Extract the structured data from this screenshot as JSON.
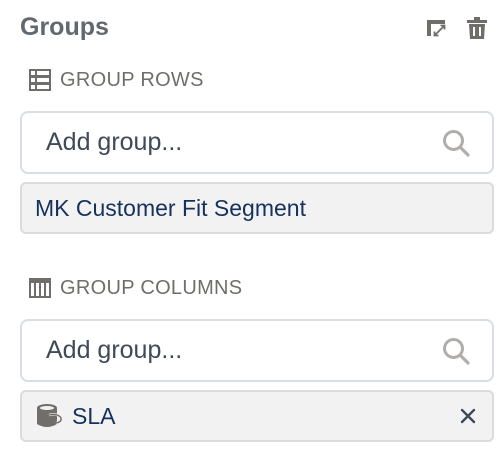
{
  "panel": {
    "title": "Groups",
    "swap_icon": "swap-axes-icon",
    "delete_icon": "trash-icon"
  },
  "group_rows": {
    "label": "GROUP ROWS",
    "icon": "rows-list-icon",
    "search": {
      "placeholder": "Add group...",
      "value": ""
    },
    "items": [
      {
        "label": "MK Customer Fit Segment"
      }
    ]
  },
  "group_columns": {
    "label": "GROUP COLUMNS",
    "icon": "columns-icon",
    "search": {
      "placeholder": "Add group...",
      "value": ""
    },
    "items": [
      {
        "label": "SLA",
        "icon": "bucket-field-icon",
        "remove_icon": "close-icon"
      }
    ]
  },
  "colors": {
    "title": "#62696e",
    "label": "#706e6b",
    "pill_text": "#16325c",
    "border": "#d8dde6",
    "pill_bg": "#f3f2f2"
  }
}
